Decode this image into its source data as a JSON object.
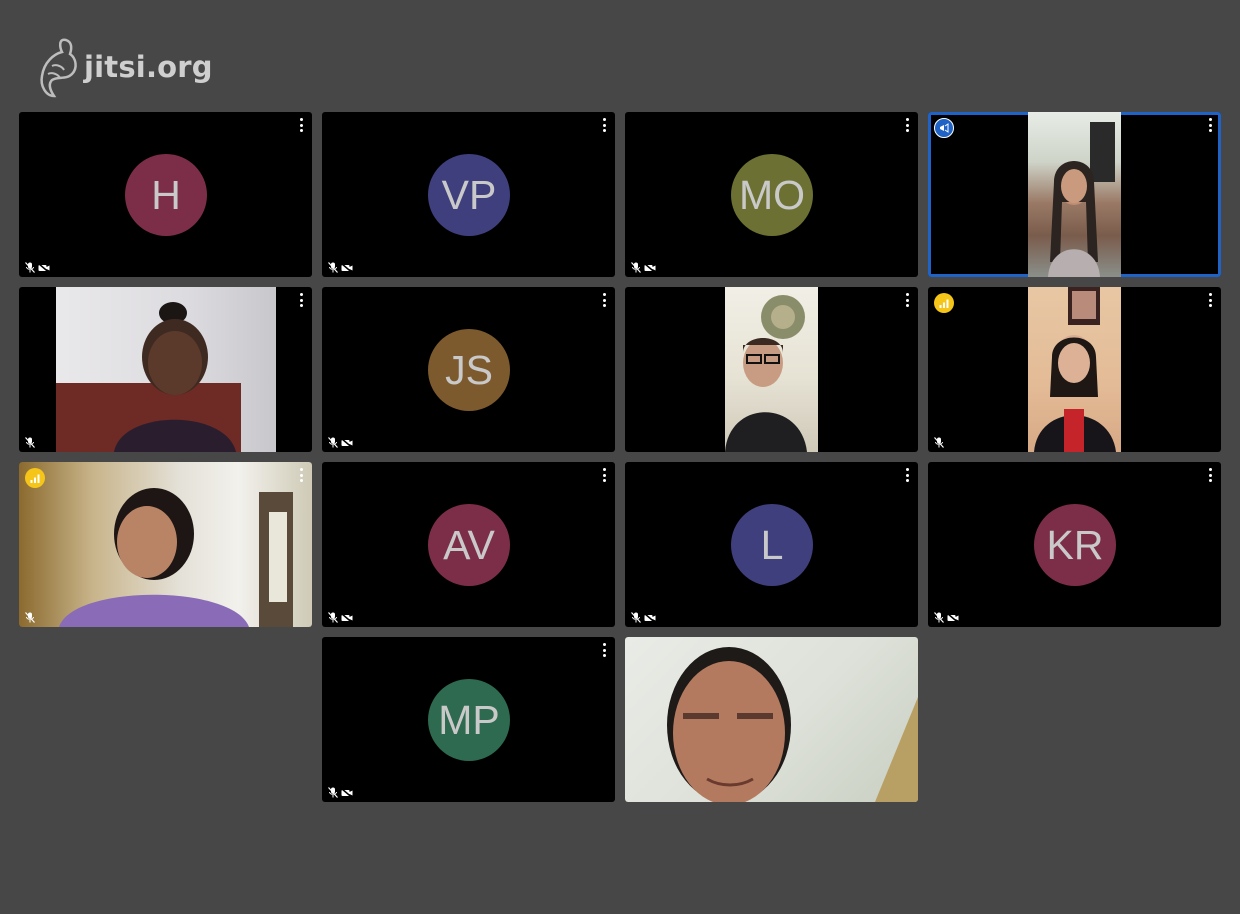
{
  "app": {
    "logo_text": "jitsi.org"
  },
  "tiles": {
    "t1": {
      "initials": "H",
      "color": "#7c2e48"
    },
    "t2": {
      "initials": "VP",
      "color": "#3f3f7e"
    },
    "t3": {
      "initials": "MO",
      "color": "#6c7133"
    },
    "t4": {
      "status": "video",
      "badge": "dominant-speaker-icon"
    },
    "t5": {
      "status": "video"
    },
    "t6": {
      "initials": "JS",
      "color": "#7c5a2e"
    },
    "t7": {
      "status": "video"
    },
    "t8": {
      "status": "video",
      "badge": "connection-quality-icon"
    },
    "t9": {
      "status": "video",
      "badge": "connection-quality-icon"
    },
    "t10": {
      "initials": "AV",
      "color": "#7c2e48"
    },
    "t11": {
      "initials": "L",
      "color": "#3f3f7e"
    },
    "t12": {
      "initials": "KR",
      "color": "#7c2e48"
    },
    "t13": {
      "initials": "MP",
      "color": "#2e6a4f"
    },
    "t14": {
      "status": "video-local"
    }
  }
}
